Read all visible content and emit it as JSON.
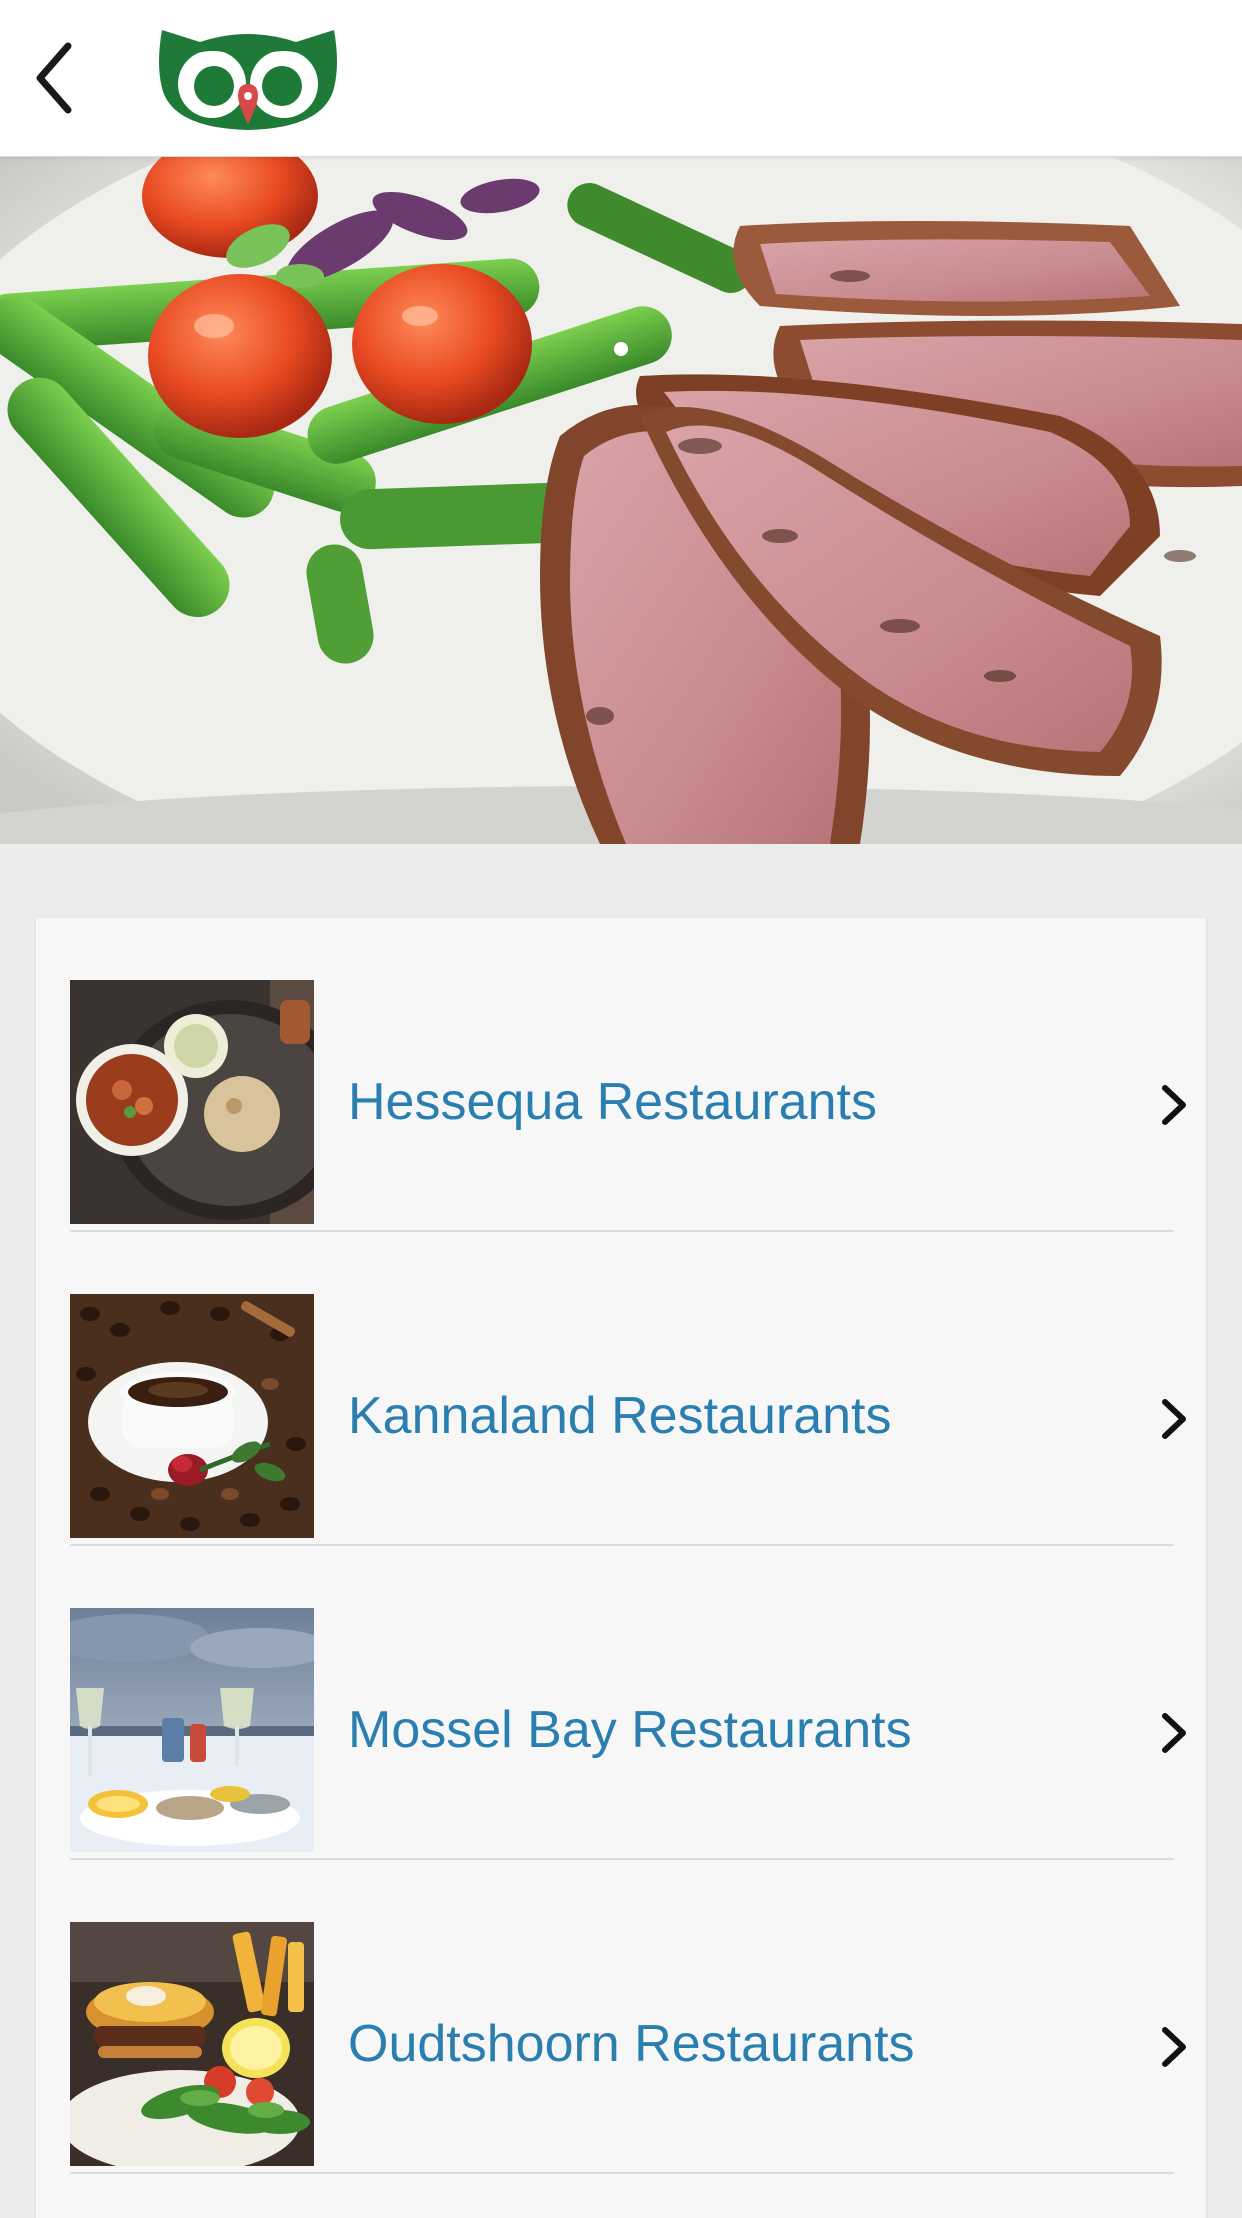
{
  "header": {
    "back_icon": "chevron-left-icon",
    "logo": "owl-logo",
    "brand_green": "#1f7a3a",
    "brand_red": "#d84a4a"
  },
  "hero": {
    "slide_count": 1,
    "active_slide": 1,
    "image": "steak-asparagus-tomatoes"
  },
  "list": {
    "accent_color": "#2a7fb0",
    "items": [
      {
        "label": "Hessequa Restaurants",
        "image": "curry-bowl-food",
        "chevron_icon": "chevron-right-icon"
      },
      {
        "label": "Kannaland Restaurants",
        "image": "coffee-cup-beans-rose",
        "chevron_icon": "chevron-right-icon"
      },
      {
        "label": "Mossel Bay Restaurants",
        "image": "seafood-wine-harbour",
        "chevron_icon": "chevron-right-icon"
      },
      {
        "label": "Oudtshoorn Restaurants",
        "image": "burger-fries-salad",
        "chevron_icon": "chevron-right-icon"
      }
    ]
  }
}
